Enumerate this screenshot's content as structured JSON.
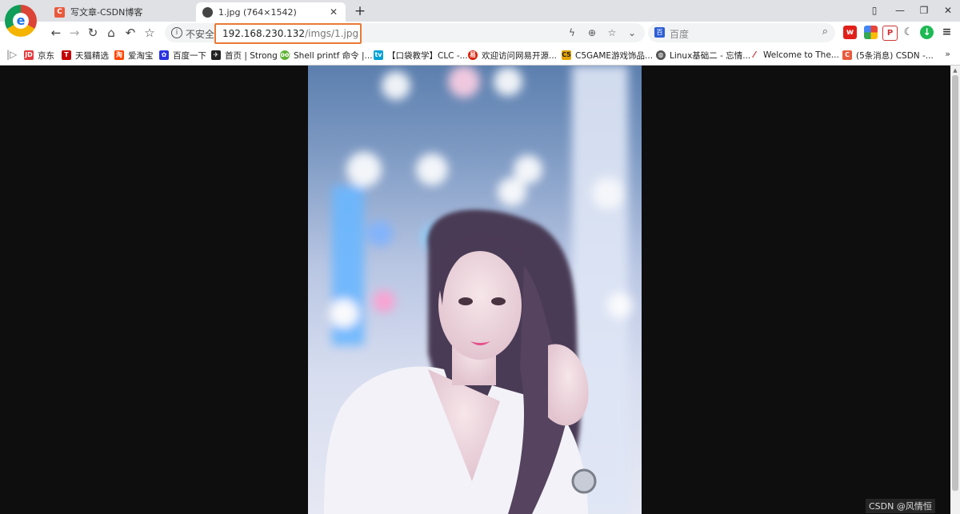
{
  "tabs": [
    {
      "title": "写文章-CSDN博客",
      "favicon": "csdn-icon"
    },
    {
      "title": "1.jpg (764×1542)",
      "favicon": "globe-icon",
      "active": true
    }
  ],
  "new_tab_label": "+",
  "window_controls": {
    "compact": "▯",
    "minimize": "—",
    "maximize": "❐",
    "close": "✕"
  },
  "nav": {
    "back": "←",
    "forward": "→",
    "reload": "↻",
    "home": "⌂",
    "undo": "↶",
    "bookmark": "☆"
  },
  "address": {
    "security_label": "不安全",
    "url_host": "192.168.230.132",
    "url_path": "/imgs/1.jpg",
    "highlight_color": "#e87a35"
  },
  "search": {
    "placeholder": "百度",
    "engine_icon": "baidu-paw-icon"
  },
  "bookmarks": [
    {
      "label": "京东",
      "icon": "jd-icon",
      "color": "#e4393c"
    },
    {
      "label": "天猫精选",
      "icon": "tmall-icon",
      "color": "#c40000"
    },
    {
      "label": "爱淘宝",
      "icon": "taobao-icon",
      "color": "#ff4400"
    },
    {
      "label": "百度一下",
      "icon": "baidu-icon",
      "color": "#2932e1"
    },
    {
      "label": "首页 | Strong",
      "icon": "bird-icon",
      "color": "#222222"
    },
    {
      "label": "Shell printf 命令 |...",
      "icon": "runoob-icon",
      "color": "#5fb336"
    },
    {
      "label": "【口袋教学】CLC -...",
      "icon": "bilibili-icon",
      "color": "#00a1d6"
    },
    {
      "label": "欢迎访问网易开源...",
      "icon": "netease-icon",
      "color": "#d81e06"
    },
    {
      "label": "C5GAME游戏饰品...",
      "icon": "c5game-icon",
      "color": "#e6a400"
    },
    {
      "label": "Linux基础二 - 忘情...",
      "icon": "globe-icon",
      "color": "#555555"
    },
    {
      "label": "Welcome to The...",
      "icon": "feather-icon",
      "color": "#d22128"
    },
    {
      "label": "(5条消息) CSDN -...",
      "icon": "csdn-icon",
      "color": "#e95a3c"
    }
  ],
  "bookmarks_more": "»",
  "image": {
    "description_icon": "photo-image",
    "background_color": "#0e0e0e"
  },
  "watermark": "CSDN @风情恒"
}
